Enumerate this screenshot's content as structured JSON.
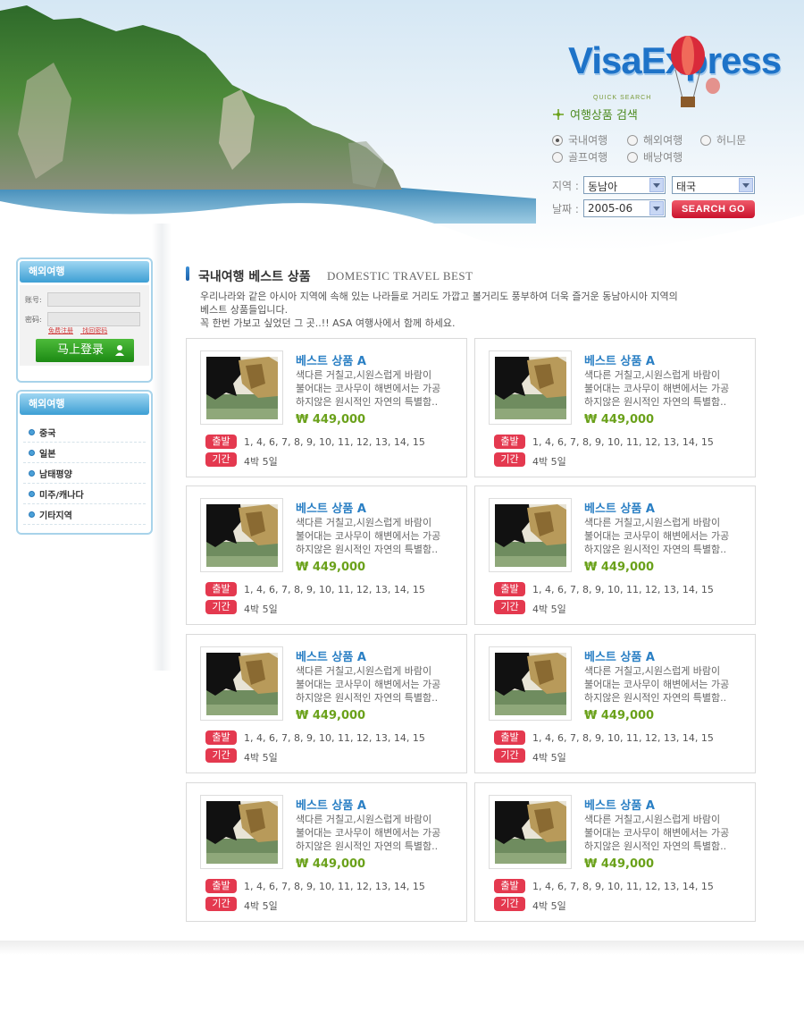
{
  "header": {
    "logo": "VisaExpress",
    "quick_search_small": "QUICK SEARCH",
    "quick_search_title": "여행상품 검색",
    "trip_types": [
      {
        "label": "국내여행",
        "selected": true
      },
      {
        "label": "해외여행",
        "selected": false
      },
      {
        "label": "허니문",
        "selected": false
      },
      {
        "label": "골프여행",
        "selected": false
      },
      {
        "label": "배낭여행",
        "selected": false
      }
    ],
    "region_label": "지역 :",
    "region_value": "동남아",
    "country_value": "태국",
    "date_label": "날짜 :",
    "date_value": "2005-06",
    "search_button": "SEARCH GO"
  },
  "sidebar": {
    "login_title": "해외여행",
    "id_label": "账号:",
    "pw_label": "密码:",
    "link_register": "免费注册",
    "link_forgot": "找回密码",
    "login_button": "马上登录",
    "menu_title": "해외여행",
    "menu_items": [
      "중국",
      "일본",
      "남태평양",
      "미주/캐나다",
      "기타지역"
    ]
  },
  "main": {
    "title_kr": "국내여행 베스트 상품",
    "title_en": "DOMESTIC TRAVEL BEST",
    "intro_lines": [
      "우리나라와 같은 아시아 지역에 속해 있는 나라들로 거리도 가깝고 볼거리도 풍부하여 더욱 즐거운 동남아시아 지역의",
      "베스트 상품들입니다.",
      "꼭 한번 가보고 싶었던 그 곳..!!  ASA 여행사에서 함께 하세요."
    ],
    "cards": [
      {
        "title": "베스트 상품 A",
        "desc": [
          "색다른 거칠고,시원스럽게 바람이",
          "불어대는 코사무이 해변에서는 가공",
          "하지않은 원시적인 자연의 특별함.."
        ],
        "price": "₩ 449,000",
        "depart_label": "출발",
        "depart": "1, 4, 6, 7, 8, 9, 10, 11, 12, 13, 14, 15",
        "period_label": "기간",
        "period": "4박 5일"
      },
      {
        "title": "베스트 상품 A",
        "desc": [
          "색다른 거칠고,시원스럽게 바람이",
          "불어대는 코사무이 해변에서는 가공",
          "하지않은 원시적인 자연의 특별함.."
        ],
        "price": "₩ 449,000",
        "depart_label": "출발",
        "depart": "1, 4, 6, 7, 8, 9, 10, 11, 12, 13, 14, 15",
        "period_label": "기간",
        "period": "4박 5일"
      },
      {
        "title": "베스트 상품 A",
        "desc": [
          "색다른 거칠고,시원스럽게 바람이",
          "불어대는 코사무이 해변에서는 가공",
          "하지않은 원시적인 자연의 특별함.."
        ],
        "price": "₩ 449,000",
        "depart_label": "출발",
        "depart": "1, 4, 6, 7, 8, 9, 10, 11, 12, 13, 14, 15",
        "period_label": "기간",
        "period": "4박 5일"
      },
      {
        "title": "베스트 상품 A",
        "desc": [
          "색다른 거칠고,시원스럽게 바람이",
          "불어대는 코사무이 해변에서는 가공",
          "하지않은 원시적인 자연의 특별함.."
        ],
        "price": "₩ 449,000",
        "depart_label": "출발",
        "depart": "1, 4, 6, 7, 8, 9, 10, 11, 12, 13, 14, 15",
        "period_label": "기간",
        "period": "4박 5일"
      },
      {
        "title": "베스트 상품 A",
        "desc": [
          "색다른 거칠고,시원스럽게 바람이",
          "불어대는 코사무이 해변에서는 가공",
          "하지않은 원시적인 자연의 특별함.."
        ],
        "price": "₩ 449,000",
        "depart_label": "출발",
        "depart": "1, 4, 6, 7, 8, 9, 10, 11, 12, 13, 14, 15",
        "period_label": "기간",
        "period": "4박 5일"
      },
      {
        "title": "베스트 상품 A",
        "desc": [
          "색다른 거칠고,시원스럽게 바람이",
          "불어대는 코사무이 해변에서는 가공",
          "하지않은 원시적인 자연의 특별함.."
        ],
        "price": "₩ 449,000",
        "depart_label": "출발",
        "depart": "1, 4, 6, 7, 8, 9, 10, 11, 12, 13, 14, 15",
        "period_label": "기간",
        "period": "4박 5일"
      },
      {
        "title": "베스트 상품 A",
        "desc": [
          "색다른 거칠고,시원스럽게 바람이",
          "불어대는 코사무이 해변에서는 가공",
          "하지않은 원시적인 자연의 특별함.."
        ],
        "price": "₩ 449,000",
        "depart_label": "출발",
        "depart": "1, 4, 6, 7, 8, 9, 10, 11, 12, 13, 14, 15",
        "period_label": "기간",
        "period": "4박 5일"
      },
      {
        "title": "베스트 상품 A",
        "desc": [
          "색다른 거칠고,시원스럽게 바람이",
          "불어대는 코사무이 해변에서는 가공",
          "하지않은 원시적인 자연의 특별함.."
        ],
        "price": "₩ 449,000",
        "depart_label": "출발",
        "depart": "1, 4, 6, 7, 8, 9, 10, 11, 12, 13, 14, 15",
        "period_label": "기간",
        "period": "4박 5일"
      }
    ]
  },
  "colors": {
    "accent_blue": "#2a7fc4",
    "price_green": "#6aa11a",
    "tag_red": "#e4394f",
    "login_green": "#1c8a14"
  }
}
